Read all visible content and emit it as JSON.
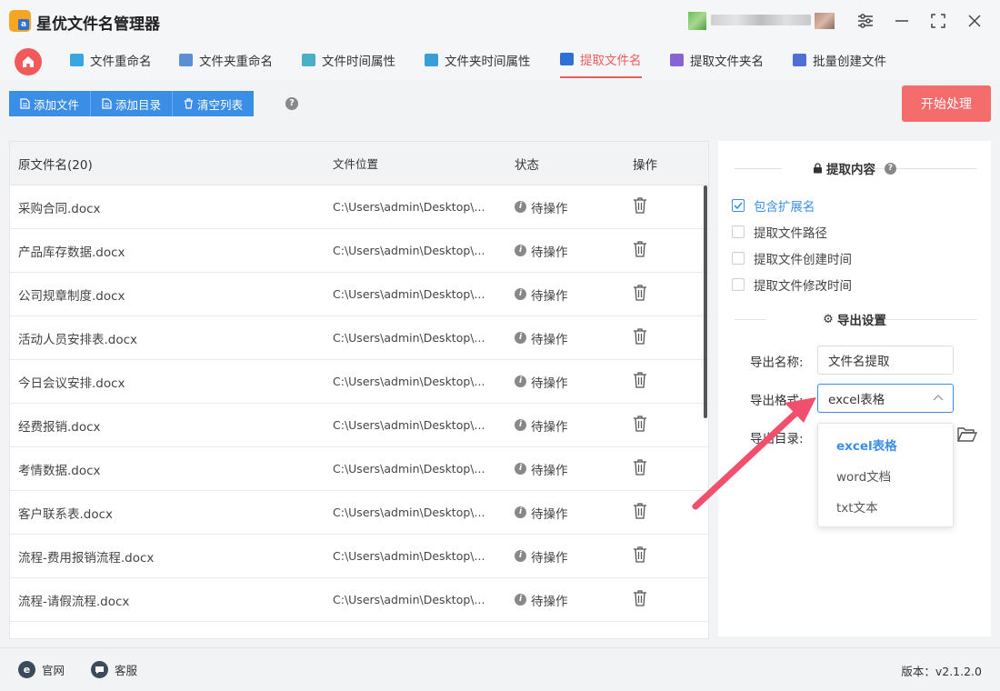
{
  "app": {
    "title": "星优文件名管理器",
    "logo_text": "a"
  },
  "window_controls": {
    "settings": "⚙",
    "minimize": "—",
    "maximize": "⛶",
    "close": "✕"
  },
  "tabs": [
    {
      "label": "文件重命名",
      "color": "#3aa6e0"
    },
    {
      "label": "文件夹重命名",
      "color": "#5b8fd6"
    },
    {
      "label": "文件时间属性",
      "color": "#4ab0c8"
    },
    {
      "label": "文件夹时间属性",
      "color": "#3a9ed6"
    },
    {
      "label": "提取文件名",
      "color": "#2f6fd6"
    },
    {
      "label": "提取文件夹名",
      "color": "#8a63d2"
    },
    {
      "label": "批量创建文件",
      "color": "#4f6fd6"
    }
  ],
  "active_tab_color": "#ef5b5b",
  "toolbar": {
    "add_file": "添加文件",
    "add_dir": "添加目录",
    "clear_list": "清空列表",
    "help": "?",
    "start": "开始处理"
  },
  "table": {
    "headers": {
      "name": "原文件名(20)",
      "path": "文件位置",
      "status": "状态",
      "op": "操作"
    },
    "rows": [
      {
        "name": "采购合同.docx",
        "path": "C:\\Users\\admin\\Desktop\\...",
        "status": "待操作"
      },
      {
        "name": "产品库存数据.docx",
        "path": "C:\\Users\\admin\\Desktop\\...",
        "status": "待操作"
      },
      {
        "name": "公司规章制度.docx",
        "path": "C:\\Users\\admin\\Desktop\\...",
        "status": "待操作"
      },
      {
        "name": "活动人员安排表.docx",
        "path": "C:\\Users\\admin\\Desktop\\...",
        "status": "待操作"
      },
      {
        "name": "今日会议安排.docx",
        "path": "C:\\Users\\admin\\Desktop\\...",
        "status": "待操作"
      },
      {
        "name": "经费报销.docx",
        "path": "C:\\Users\\admin\\Desktop\\...",
        "status": "待操作"
      },
      {
        "name": "考情数据.docx",
        "path": "C:\\Users\\admin\\Desktop\\...",
        "status": "待操作"
      },
      {
        "name": "客户联系表.docx",
        "path": "C:\\Users\\admin\\Desktop\\...",
        "status": "待操作"
      },
      {
        "name": "流程-费用报销流程.docx",
        "path": "C:\\Users\\admin\\Desktop\\...",
        "status": "待操作"
      },
      {
        "name": "流程-请假流程.docx",
        "path": "C:\\Users\\admin\\Desktop\\...",
        "status": "待操作"
      }
    ]
  },
  "panel": {
    "extract_title": "提取内容",
    "checkboxes": [
      {
        "label": "包含扩展名",
        "checked": true
      },
      {
        "label": "提取文件路径",
        "checked": false
      },
      {
        "label": "提取文件创建时间",
        "checked": false
      },
      {
        "label": "提取文件修改时间",
        "checked": false
      }
    ],
    "export_title": "导出设置",
    "export_name_label": "导出名称:",
    "export_name_value": "文件名提取",
    "export_format_label": "导出格式:",
    "export_format_value": "excel表格",
    "export_dir_label": "导出目录:",
    "format_options": [
      "excel表格",
      "word文档",
      "txt文本"
    ]
  },
  "footer": {
    "website": "官网",
    "support": "客服",
    "version": "版本：v2.1.2.0"
  },
  "colors": {
    "accent": "#3a8ee6",
    "start": "#f56c6c",
    "arrow": "#f0506e"
  }
}
